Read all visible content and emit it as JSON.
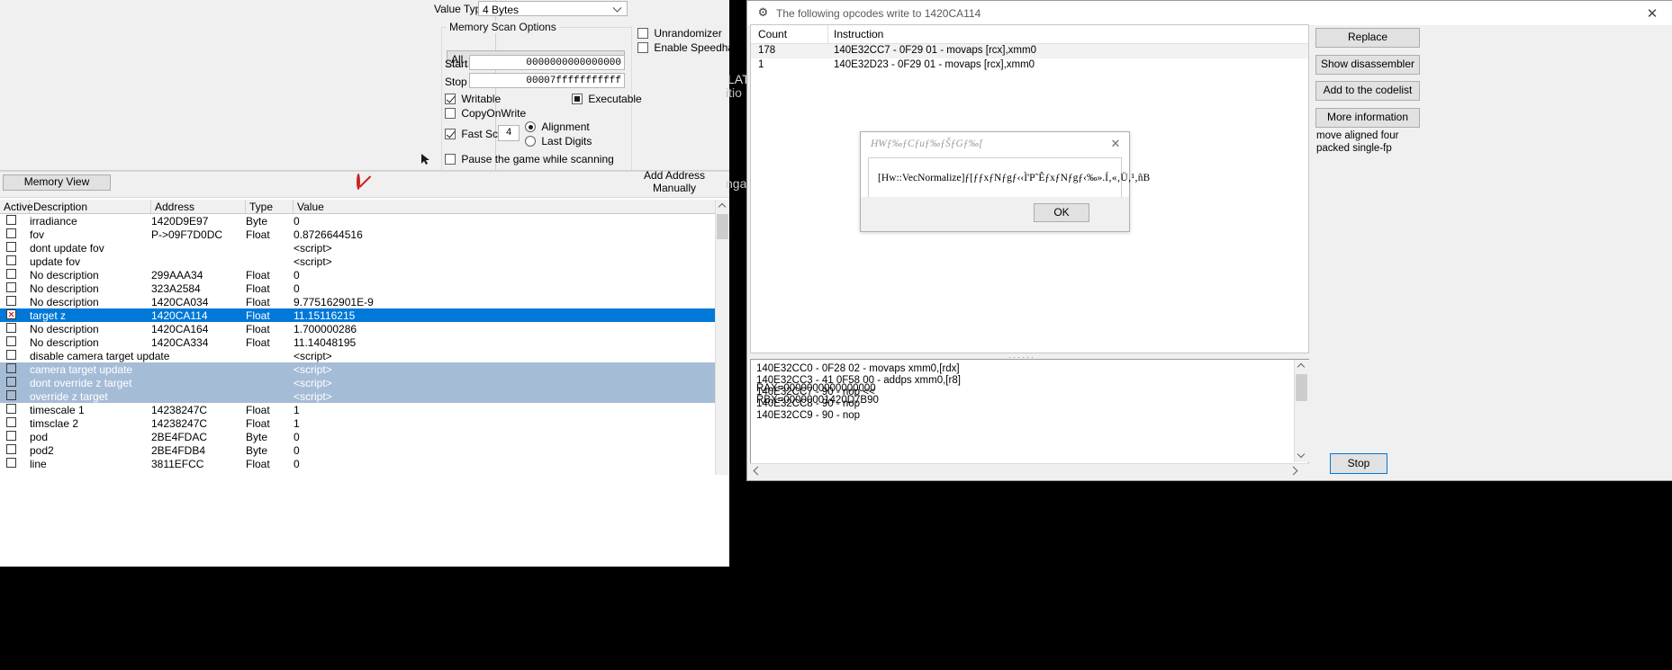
{
  "scanner": {
    "value_type_label": "Value Type",
    "value_type_value": "4 Bytes",
    "memory_scan_options_legend": "Memory Scan Options",
    "region_select_value": "All",
    "start_label": "Start",
    "start_value": "0000000000000000",
    "stop_label": "Stop",
    "stop_value": "00007fffffffffff",
    "writable_label": "Writable",
    "executable_label": "Executable",
    "copyonwrite_label": "CopyOnWrite",
    "fast_scan_label": "Fast Scan",
    "fast_scan_value": "4",
    "alignment_label": "Alignment",
    "last_digits_label": "Last Digits",
    "pause_label": "Pause the game while scanning",
    "unrandomizer_label": "Unrandomizer",
    "enable_speedhack_label": "Enable Speedhack"
  },
  "toolbar": {
    "memory_view_label": "Memory View",
    "add_address_manually_label": "Add Address Manually",
    "stop_icon": "no-entry-icon"
  },
  "address_list": {
    "columns": [
      "Active",
      "Description",
      "Address",
      "Type",
      "Value"
    ],
    "rows": [
      {
        "active": "",
        "desc": "irradiance",
        "addr": "1420D9E97",
        "type": "Byte",
        "val": "0",
        "state": "normal"
      },
      {
        "active": "",
        "desc": "fov",
        "addr": "P->09F7D0DC",
        "type": "Float",
        "val": "0.8726644516",
        "state": "normal"
      },
      {
        "active": "",
        "desc": "dont update fov",
        "addr": "",
        "type": "",
        "val": "<script>",
        "state": "normal"
      },
      {
        "active": "",
        "desc": "update fov",
        "addr": "",
        "type": "",
        "val": "<script>",
        "state": "normal"
      },
      {
        "active": "",
        "desc": "No description",
        "addr": "299AAA34",
        "type": "Float",
        "val": "0",
        "state": "normal"
      },
      {
        "active": "",
        "desc": "No description",
        "addr": "323A2584",
        "type": "Float",
        "val": "0",
        "state": "normal"
      },
      {
        "active": "",
        "desc": "No description",
        "addr": "1420CA034",
        "type": "Float",
        "val": "9.775162901E-9",
        "state": "normal"
      },
      {
        "active": "x",
        "desc": "target z",
        "addr": "1420CA114",
        "type": "Float",
        "val": "11.15116215",
        "state": "selected"
      },
      {
        "active": "",
        "desc": "No description",
        "addr": "1420CA164",
        "type": "Float",
        "val": "1.700000286",
        "state": "normal"
      },
      {
        "active": "",
        "desc": "No description",
        "addr": "1420CA334",
        "type": "Float",
        "val": "11.14048195",
        "state": "normal"
      },
      {
        "active": "",
        "desc": "disable camera target update",
        "addr": "",
        "type": "",
        "val": "<script>",
        "state": "normal"
      },
      {
        "active": "",
        "desc": "camera target update",
        "addr": "",
        "type": "",
        "val": "<script>",
        "state": "group"
      },
      {
        "active": "",
        "desc": "dont override z target",
        "addr": "",
        "type": "",
        "val": "<script>",
        "state": "group"
      },
      {
        "active": "",
        "desc": "override z target",
        "addr": "",
        "type": "",
        "val": "<script>",
        "state": "group"
      },
      {
        "active": "",
        "desc": "timescale 1",
        "addr": "14238247C",
        "type": "Float",
        "val": "1",
        "state": "normal"
      },
      {
        "active": "",
        "desc": "timsclae 2",
        "addr": "14238247C",
        "type": "Float",
        "val": "1",
        "state": "normal"
      },
      {
        "active": "",
        "desc": "pod",
        "addr": "2BE4FDAC",
        "type": "Byte",
        "val": "0",
        "state": "normal"
      },
      {
        "active": "",
        "desc": "pod2",
        "addr": "2BE4FDB4",
        "type": "Byte",
        "val": "0",
        "state": "normal"
      },
      {
        "active": "",
        "desc": "line",
        "addr": "3811EFCC",
        "type": "Float",
        "val": "0",
        "state": "normal"
      }
    ]
  },
  "opcode_window": {
    "title": "The following opcodes write to 1420CA114",
    "icon": "cheat-engine-icon",
    "close_icon": "close-icon",
    "columns": [
      "Count",
      "Instruction"
    ],
    "rows": [
      {
        "count": "178",
        "instruction": "140E32CC7 - 0F29 01  - movaps [rcx],xmm0"
      },
      {
        "count": "1",
        "instruction": "140E32D23 - 0F29 01  - movaps [rcx],xmm0"
      }
    ],
    "buttons": [
      "Replace",
      "Show disassembler",
      "Add to the codelist",
      "More information"
    ],
    "hint_text": "move aligned four packed single-fp",
    "stop_button": "Stop",
    "disassembly": [
      "140E32CC0 - 0F28 02  - movaps xmm0,[rdx]",
      "140E32CC3 - 41 0F58 00  - addps xmm0,[r8]",
      "140E32CC7 - 90 - nop  <<",
      "140E32CC8 - 90 - nop",
      "140E32CC9 - 90 - nop"
    ],
    "registers": [
      "RAX=0000000000000000",
      "RBX=00000001420D7B90"
    ]
  },
  "modal": {
    "title": "HWƒ‰ƒCƒuƒ‰ƒŠƒGƒ‰[",
    "body": "[Hw::VecNormalize]ƒ[ƒƒxƒNƒgƒ‹‹Ì'P˜ÊƒxƒNƒgƒ‹‰».Í‚«‚Ü‚¹‚ñB",
    "ok_label": "OK",
    "close_icon": "close-icon"
  },
  "background": {
    "watermark_a": "LAT",
    "watermark_b": "itio",
    "watermark_c": "nga"
  }
}
